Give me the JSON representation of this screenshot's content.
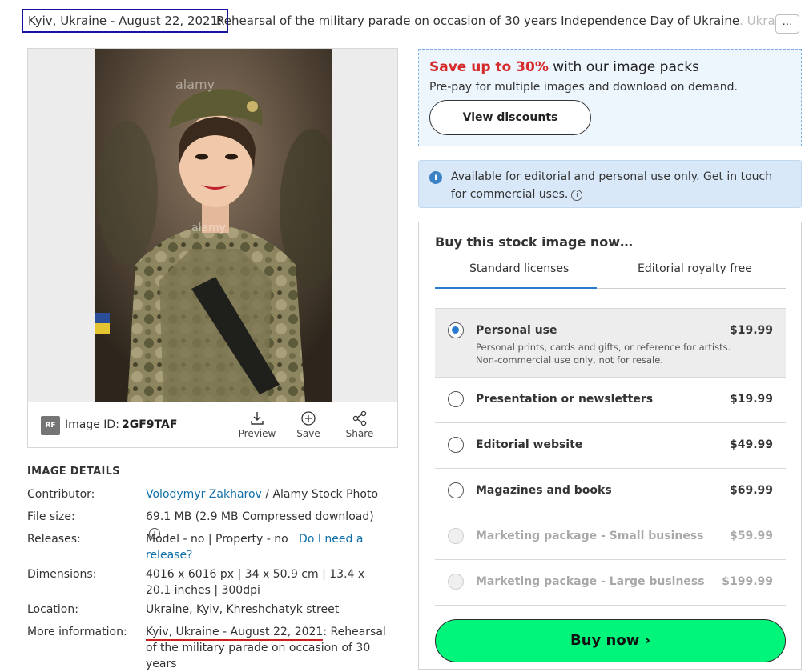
{
  "caption": {
    "boxed": "Kyiv, Ukraine - August 22, 2021",
    "separator": ":",
    "text": " Rehearsal of the military parade on occasion of ",
    "highlight": "30 years Independence Day of Ukraine",
    "tail": ". Ukrai"
  },
  "more_button": "…",
  "image": {
    "watermark": "alamy",
    "rf_badge": "RF",
    "id_label": "Image ID:",
    "id_value": "2GF9TAF",
    "tools": {
      "preview": "Preview",
      "save": "Save",
      "share": "Share"
    }
  },
  "details": {
    "title": "IMAGE DETAILS",
    "contributor_label": "Contributor:",
    "contributor_name": "Volodymyr Zakharov",
    "contributor_suffix": " / Alamy Stock Photo",
    "filesize_label": "File size:",
    "filesize_value": "69.1 MB (2.9 MB Compressed download)",
    "releases_label": "Releases:",
    "releases_value": "Model - no | Property - no",
    "releases_link": "Do I need a release?",
    "dimensions_label": "Dimensions:",
    "dimensions_value": "4016 x 6016 px | 34 x 50.9 cm | 13.4 x 20.1 inches | 300dpi",
    "location_label": "Location:",
    "location_value": "Ukraine, Kyiv, Khreshchatyk street",
    "more_label": "More information:",
    "more_value_underlined": "Kyiv, Ukraine - August 22, 2021",
    "more_value_rest": ": Rehearsal of the military parade on occasion of 30 years"
  },
  "promo": {
    "accent": "Save up to 30%",
    "title_rest": " with our image packs",
    "subtitle": "Pre-pay for multiple images and download on demand.",
    "button": "View discounts"
  },
  "notice": {
    "icon": "i",
    "text": "Available for editorial and personal use only. Get in touch for commercial uses."
  },
  "buy": {
    "title": "Buy this stock image now…",
    "tabs": [
      "Standard licenses",
      "Editorial royalty free"
    ],
    "licenses": [
      {
        "name": "Personal use",
        "price": "$19.99",
        "desc": "Personal prints, cards and gifts, or reference for artists. Non-commercial use only, not for resale."
      },
      {
        "name": "Presentation or newsletters",
        "price": "$19.99"
      },
      {
        "name": "Editorial website",
        "price": "$49.99"
      },
      {
        "name": "Magazines and books",
        "price": "$69.99"
      },
      {
        "name": "Marketing package - Small business",
        "price": "$59.99"
      },
      {
        "name": "Marketing package - Large business",
        "price": "$199.99"
      }
    ],
    "button": "Buy now ›"
  },
  "colors": {
    "accent_red": "#d52b2b",
    "link_blue": "#0f6fa8",
    "buy_green": "#00f57a",
    "tab_blue": "#2a7bd0",
    "caption_box": "#1414a0"
  }
}
